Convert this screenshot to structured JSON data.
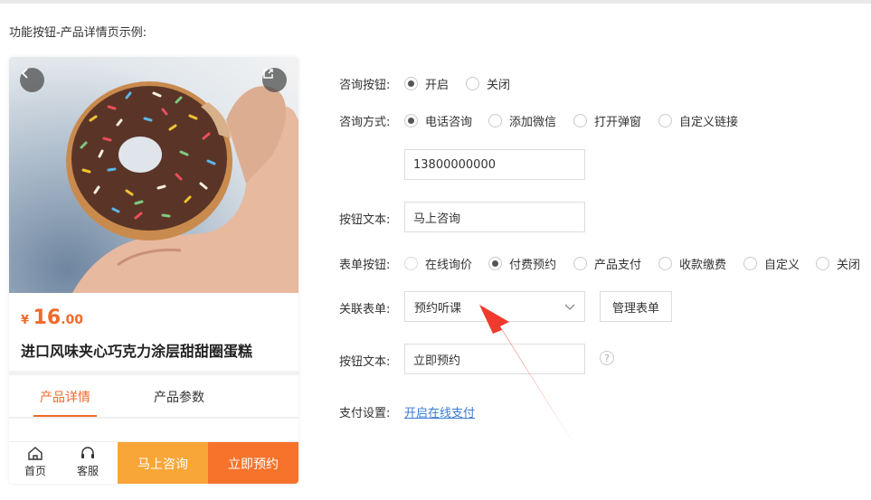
{
  "heading": "功能按钮-产品详情页示例:",
  "preview": {
    "price_currency": "¥",
    "price_int": "16",
    "price_dec": ".00",
    "product_title": "进口风味夹心巧克力涂层甜甜圈蛋糕",
    "tabs": [
      "产品详情",
      "产品参数"
    ],
    "nav": {
      "home": "首页",
      "service": "客服"
    },
    "consult_button": "马上咨询",
    "book_button": "立即预约",
    "icons": {
      "back": "back-arrow-icon",
      "share": "share-icon",
      "home": "home-icon",
      "service": "headset-icon"
    }
  },
  "form": {
    "consult_button": {
      "label": "咨询按钮:",
      "options": [
        "开启",
        "关闭"
      ],
      "selected": "开启"
    },
    "consult_method": {
      "label": "咨询方式:",
      "options": [
        "电话咨询",
        "添加微信",
        "打开弹窗",
        "自定义链接"
      ],
      "selected": "电话咨询"
    },
    "phone_value": "13800000000",
    "button_text_1": {
      "label": "按钮文本:",
      "value": "马上咨询"
    },
    "form_button": {
      "label": "表单按钮:",
      "options": [
        "在线询价",
        "付费预约",
        "产品支付",
        "收款缴费",
        "自定义",
        "关闭"
      ],
      "selected": "付费预约"
    },
    "linked_form": {
      "label": "关联表单:",
      "value": "预约听课",
      "manage_label": "管理表单"
    },
    "button_text_2": {
      "label": "按钮文本:",
      "value": "立即预约",
      "help": "?"
    },
    "payment": {
      "label": "支付设置:",
      "link": "开启在线支付"
    }
  },
  "colors": {
    "accent": "#f06a2b",
    "consult_btn": "#f8a637",
    "book_btn": "#f7732b",
    "link": "#3a7bd5",
    "annotation_arrow": "#f03a2e"
  }
}
